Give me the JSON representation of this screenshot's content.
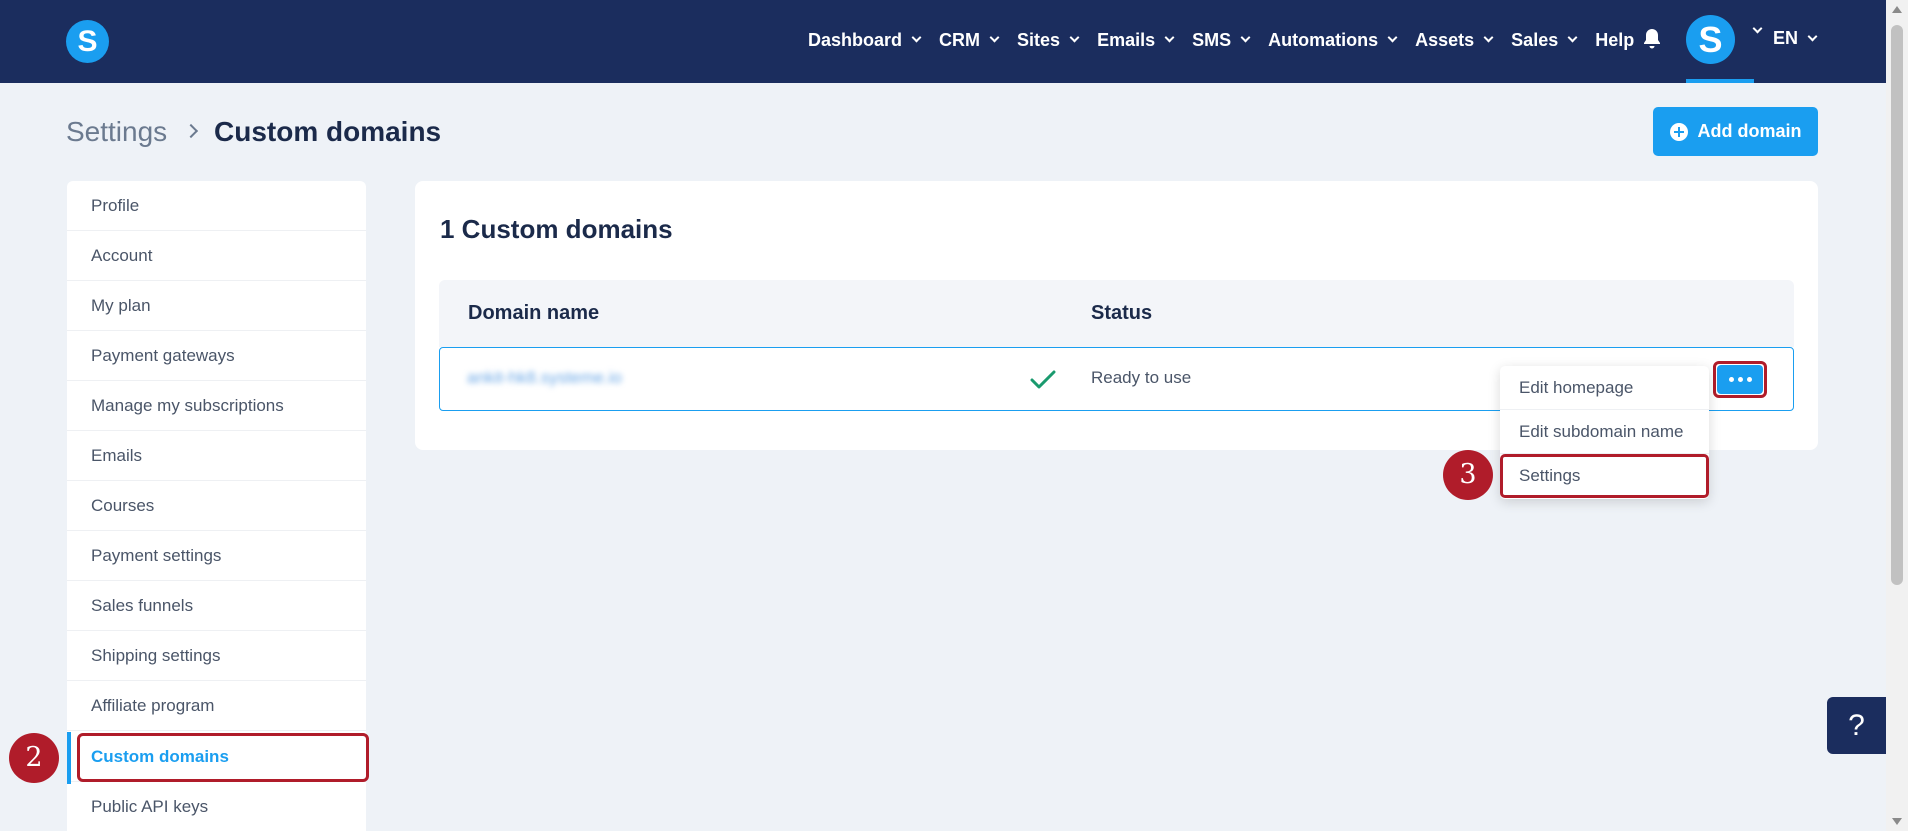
{
  "header": {
    "logo_letter": "S",
    "nav": [
      "Dashboard",
      "CRM",
      "Sites",
      "Emails",
      "SMS",
      "Automations",
      "Assets",
      "Sales",
      "Help"
    ],
    "avatar_letter": "S",
    "language": "EN"
  },
  "breadcrumb": {
    "parent": "Settings",
    "current": "Custom domains"
  },
  "add_button": "Add domain",
  "sidebar": {
    "items": [
      "Profile",
      "Account",
      "My plan",
      "Payment gateways",
      "Manage my subscriptions",
      "Emails",
      "Courses",
      "Payment settings",
      "Sales funnels",
      "Shipping settings",
      "Affiliate program",
      "Custom domains",
      "Public API keys"
    ],
    "active_index": 11
  },
  "main": {
    "title": "1 Custom domains",
    "columns": {
      "domain": "Domain name",
      "status": "Status"
    },
    "row": {
      "domain": "ankit-hk8.systeme.io",
      "status": "Ready to use"
    }
  },
  "menu": {
    "items": [
      "Edit homepage",
      "Edit subdomain name",
      "Settings"
    ]
  },
  "steps": {
    "sidebar_step": "2",
    "menu_step": "3"
  },
  "help_label": "?",
  "colors": {
    "nav_bg": "#1b2d5e",
    "accent": "#1a9ef0",
    "highlight": "#b01c2a",
    "success": "#1a9a6e"
  }
}
